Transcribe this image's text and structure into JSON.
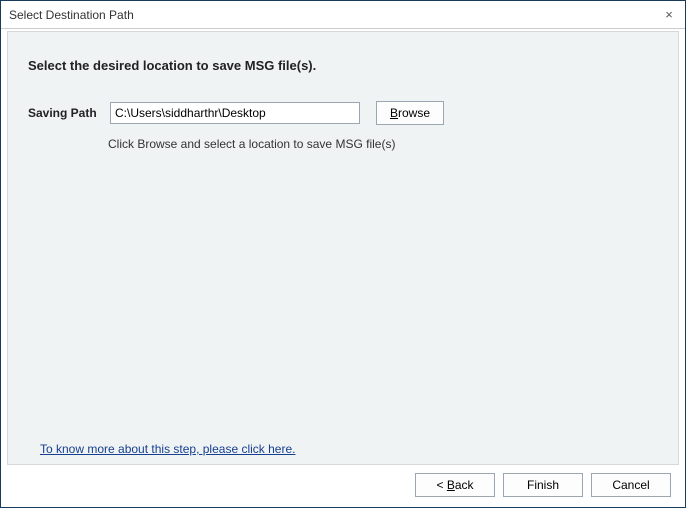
{
  "titlebar": {
    "title": "Select Destination Path",
    "close_label": "×"
  },
  "content": {
    "instruction": "Select the desired location to save MSG file(s).",
    "saving_path_label": "Saving Path",
    "path_value": "C:\\Users\\siddharthr\\Desktop",
    "browse_prefix": "B",
    "browse_rest": "rowse",
    "hint": "Click Browse and select a location to save MSG file(s)",
    "help_link": "To know more about this step, please click here."
  },
  "footer": {
    "back_prefix": "< ",
    "back_u": "B",
    "back_rest": "ack",
    "finish_label": "Finish",
    "cancel_label": "Cancel"
  }
}
